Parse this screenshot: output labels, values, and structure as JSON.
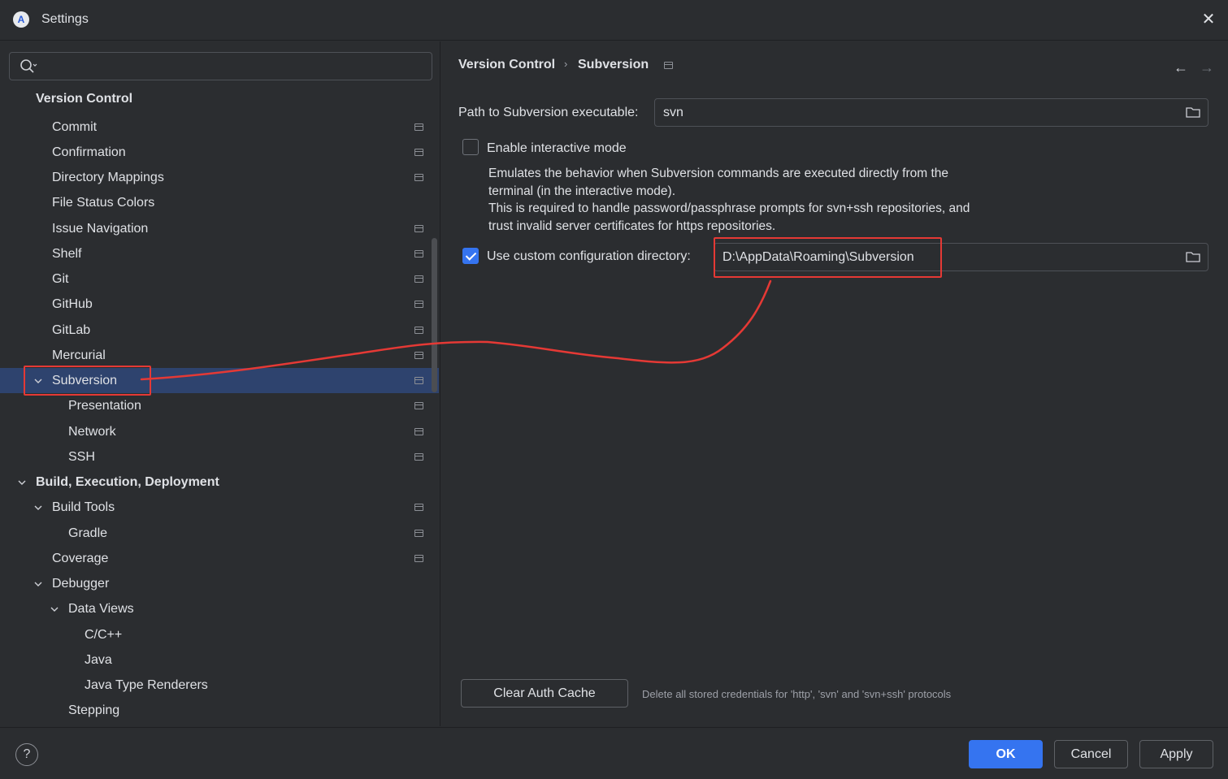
{
  "window": {
    "title": "Settings",
    "app_icon": "android-studio-icon",
    "close_icon": "close-icon"
  },
  "sidebar": {
    "search_placeholder": "",
    "items": [
      {
        "label": "Version Control",
        "bold": true,
        "expandable": false,
        "has_project_icon": false
      },
      {
        "label": "Commit",
        "has_project_icon": true
      },
      {
        "label": "Confirmation",
        "has_project_icon": true
      },
      {
        "label": "Directory Mappings",
        "has_project_icon": true
      },
      {
        "label": "File Status Colors",
        "has_project_icon": false
      },
      {
        "label": "Issue Navigation",
        "has_project_icon": true
      },
      {
        "label": "Shelf",
        "has_project_icon": true
      },
      {
        "label": "Git",
        "has_project_icon": true
      },
      {
        "label": "GitHub",
        "has_project_icon": true
      },
      {
        "label": "GitLab",
        "has_project_icon": true
      },
      {
        "label": "Mercurial",
        "has_project_icon": true
      },
      {
        "label": "Subversion",
        "expanded": true,
        "selected": true,
        "has_project_icon": true
      },
      {
        "label": "Presentation",
        "has_project_icon": true
      },
      {
        "label": "Network",
        "has_project_icon": true
      },
      {
        "label": "SSH",
        "has_project_icon": true
      },
      {
        "label": "Build, Execution, Deployment",
        "bold": true,
        "expanded": true,
        "has_project_icon": false
      },
      {
        "label": "Build Tools",
        "expanded": true,
        "has_project_icon": true
      },
      {
        "label": "Gradle",
        "has_project_icon": true
      },
      {
        "label": "Coverage",
        "has_project_icon": true
      },
      {
        "label": "Debugger",
        "expanded": true,
        "has_project_icon": false
      },
      {
        "label": "Data Views",
        "expanded": true,
        "has_project_icon": false
      },
      {
        "label": "C/C++",
        "has_project_icon": false
      },
      {
        "label": "Java",
        "has_project_icon": false
      },
      {
        "label": "Java Type Renderers",
        "has_project_icon": false
      },
      {
        "label": "Stepping",
        "has_project_icon": false
      }
    ]
  },
  "main": {
    "breadcrumb": {
      "parent": "Version Control",
      "separator": "›",
      "current": "Subversion"
    },
    "nav": {
      "back_icon": "arrow-left-icon",
      "forward_icon": "arrow-right-icon"
    },
    "path_label": "Path to Subversion executable:",
    "path_value": "svn",
    "interactive_mode": {
      "label": "Enable interactive mode",
      "checked": false
    },
    "description": {
      "line1": "Emulates the behavior when Subversion commands are executed directly from the",
      "line2": "terminal (in the interactive mode).",
      "line3": "This is required to handle password/passphrase prompts for svn+ssh repositories, and",
      "line4": "trust invalid server certificates for https repositories."
    },
    "custom_config": {
      "label": "Use custom configuration directory:",
      "checked": true,
      "value": "D:\\AppData\\Roaming\\Subversion"
    },
    "clear_auth": {
      "button": "Clear Auth Cache",
      "hint": "Delete all stored credentials for 'http', 'svn' and 'svn+ssh' protocols"
    }
  },
  "footer": {
    "help": "?",
    "ok": "OK",
    "cancel": "Cancel",
    "apply": "Apply"
  },
  "colors": {
    "accent": "#3574f0",
    "selection": "#2e436e",
    "annotation": "#e53935",
    "background": "#2b2d30"
  }
}
